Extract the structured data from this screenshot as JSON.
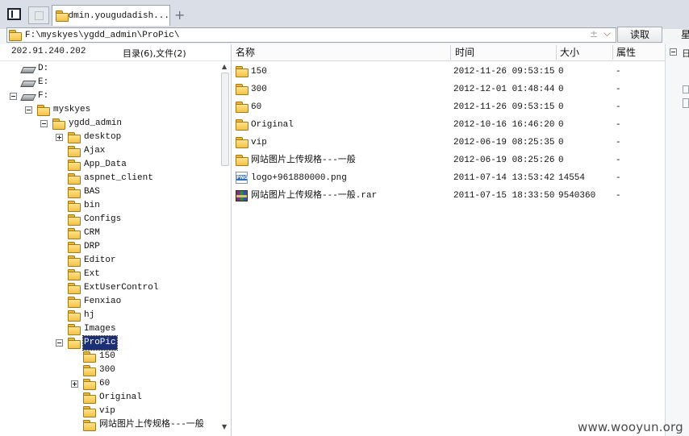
{
  "tab": {
    "title": "admin.yougudadish..."
  },
  "address": {
    "path": "F:\\myskyes\\ygdd_admin\\ProPic\\",
    "read_label": "读取",
    "more_label": "星"
  },
  "left": {
    "ip": "202.91.240.202",
    "summary": "目录(6),文件(2)",
    "tree": [
      {
        "label": "D:",
        "level": 0,
        "icon": "drive-icon"
      },
      {
        "label": "E:",
        "level": 0,
        "icon": "drive-icon"
      },
      {
        "label": "F:",
        "level": 0,
        "icon": "drive-icon",
        "expander": "minus"
      },
      {
        "label": "myskyes",
        "level": 1,
        "icon": "folder-icon",
        "expander": "minus"
      },
      {
        "label": "ygdd_admin",
        "level": 2,
        "icon": "folder-icon",
        "expander": "minus"
      },
      {
        "label": "desktop",
        "level": 3,
        "icon": "folder-icon",
        "expander": "plus"
      },
      {
        "label": "Ajax",
        "level": 3,
        "icon": "folder-icon"
      },
      {
        "label": "App_Data",
        "level": 3,
        "icon": "folder-icon"
      },
      {
        "label": "aspnet_client",
        "level": 3,
        "icon": "folder-icon"
      },
      {
        "label": "BAS",
        "level": 3,
        "icon": "folder-icon"
      },
      {
        "label": "bin",
        "level": 3,
        "icon": "folder-icon"
      },
      {
        "label": "Configs",
        "level": 3,
        "icon": "folder-icon"
      },
      {
        "label": "CRM",
        "level": 3,
        "icon": "folder-icon"
      },
      {
        "label": "DRP",
        "level": 3,
        "icon": "folder-icon"
      },
      {
        "label": "Editor",
        "level": 3,
        "icon": "folder-icon"
      },
      {
        "label": "Ext",
        "level": 3,
        "icon": "folder-icon"
      },
      {
        "label": "ExtUserControl",
        "level": 3,
        "icon": "folder-icon"
      },
      {
        "label": "Fenxiao",
        "level": 3,
        "icon": "folder-icon"
      },
      {
        "label": "hj",
        "level": 3,
        "icon": "folder-icon"
      },
      {
        "label": "Images",
        "level": 3,
        "icon": "folder-icon"
      },
      {
        "label": "ProPic",
        "level": 3,
        "icon": "folder-icon",
        "expander": "minus",
        "selected": true
      },
      {
        "label": "150",
        "level": 4,
        "icon": "folder-icon"
      },
      {
        "label": "300",
        "level": 4,
        "icon": "folder-icon"
      },
      {
        "label": "60",
        "level": 4,
        "icon": "folder-icon",
        "expander": "plus"
      },
      {
        "label": "Original",
        "level": 4,
        "icon": "folder-icon"
      },
      {
        "label": "vip",
        "level": 4,
        "icon": "folder-icon"
      },
      {
        "label": "网站图片上传规格---一般",
        "level": 4,
        "icon": "folder-icon"
      }
    ]
  },
  "list": {
    "headers": {
      "name": "名称",
      "time": "时间",
      "size": "大小",
      "attr": "属性"
    },
    "rows": [
      {
        "name": "150",
        "time": "2012-11-26 09:53:15",
        "size": "0",
        "attr": "-",
        "icon": "folder-icon"
      },
      {
        "name": "300",
        "time": "2012-12-01 01:48:44",
        "size": "0",
        "attr": "-",
        "icon": "folder-icon"
      },
      {
        "name": "60",
        "time": "2012-11-26 09:53:15",
        "size": "0",
        "attr": "-",
        "icon": "folder-icon"
      },
      {
        "name": "Original",
        "time": "2012-10-16 16:46:20",
        "size": "0",
        "attr": "-",
        "icon": "folder-icon"
      },
      {
        "name": "vip",
        "time": "2012-06-19 08:25:35",
        "size": "0",
        "attr": "-",
        "icon": "folder-icon"
      },
      {
        "name": "网站图片上传规格---一般",
        "time": "2012-06-19 08:25:26",
        "size": "0",
        "attr": "-",
        "icon": "folder-icon"
      },
      {
        "name": "logo+961880000.png",
        "time": "2011-07-14 13:53:42",
        "size": "14554",
        "attr": "-",
        "icon": "png-file-icon"
      },
      {
        "name": "网站图片上传规格---一般.rar",
        "time": "2011-07-15 18:33:50",
        "size": "9540360",
        "attr": "-",
        "icon": "rar-file-icon"
      }
    ]
  },
  "right_strip": {
    "label": "日"
  },
  "watermark": "www.wooyun.org"
}
